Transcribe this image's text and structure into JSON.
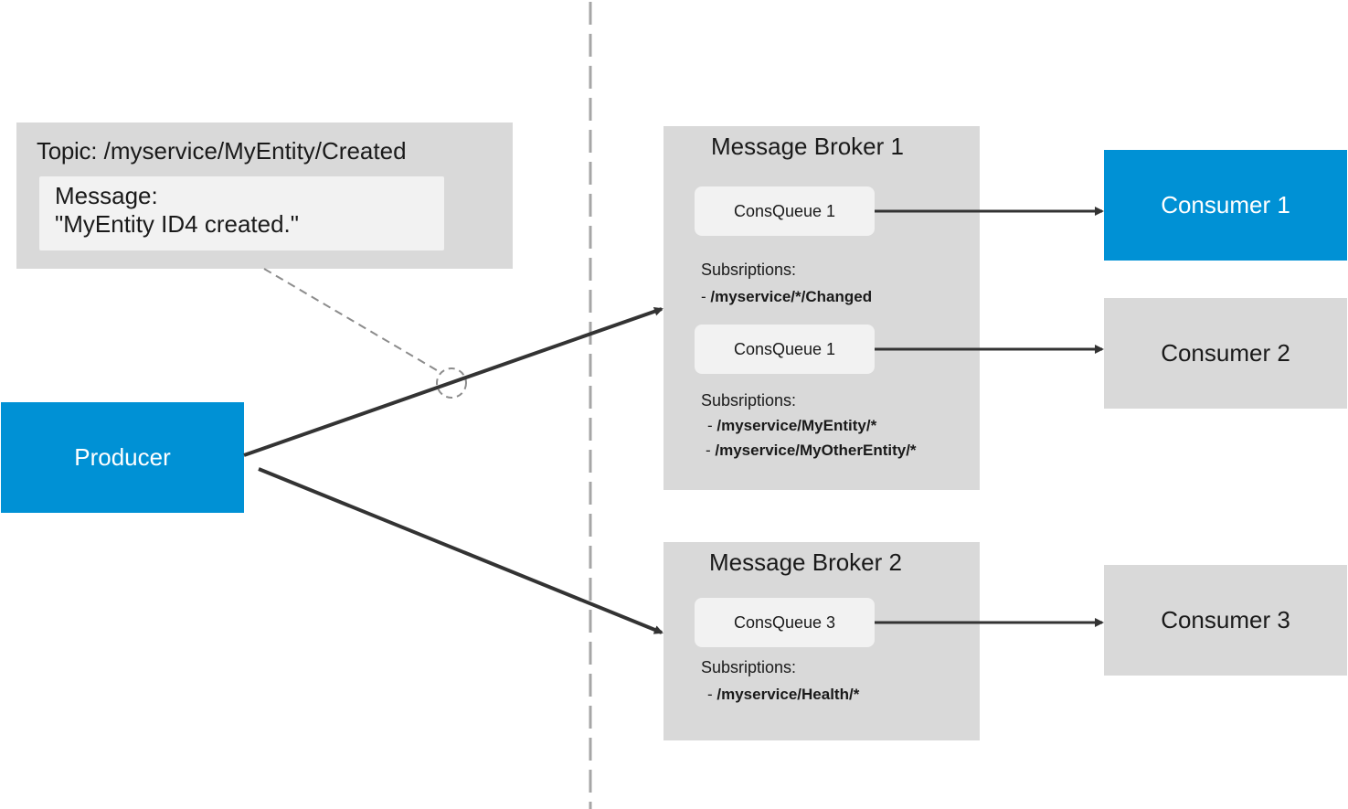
{
  "colors": {
    "accent_blue": "#0091d5",
    "box_gray": "#d9d9d9",
    "box_light": "#f2f2f2",
    "arrow": "#333333",
    "divider": "#a6a6a6"
  },
  "message_card": {
    "topic_label": "Topic",
    "topic_separator": ":",
    "topic_value": " /myservice/MyEntity/Created",
    "message_label": "Message",
    "message_separator": ":",
    "message_text": "\"MyEntity ID4 created.\""
  },
  "producer": {
    "label": "Producer"
  },
  "brokers": [
    {
      "title": "Message Broker 1",
      "queues": [
        {
          "name": "ConsQueue 1",
          "subscriptions_label": "Subsriptions:",
          "subscriptions": [
            "/myservice/*/Changed"
          ]
        },
        {
          "name": "ConsQueue 1",
          "subscriptions_label": "Subsriptions:",
          "subscriptions": [
            "/myservice/MyEntity/*",
            "/myservice/MyOtherEntity/*"
          ]
        }
      ]
    },
    {
      "title": "Message Broker 2",
      "queues": [
        {
          "name": "ConsQueue 3",
          "subscriptions_label": "Subsriptions:",
          "subscriptions": [
            "/myservice/Health/*"
          ]
        }
      ]
    }
  ],
  "consumers": [
    {
      "label": "Consumer 1",
      "highlighted": true
    },
    {
      "label": "Consumer 2",
      "highlighted": false
    },
    {
      "label": "Consumer 3",
      "highlighted": false
    }
  ],
  "edges": [
    {
      "from": "Producer",
      "to": "Message Broker 1",
      "style": "solid-arrow"
    },
    {
      "from": "Producer",
      "to": "Message Broker 2",
      "style": "solid-arrow"
    },
    {
      "from": "ConsQueue 1",
      "to": "Consumer 1",
      "style": "solid-arrow"
    },
    {
      "from": "ConsQueue 1",
      "to": "Consumer 2",
      "style": "solid-arrow"
    },
    {
      "from": "ConsQueue 3",
      "to": "Consumer 3",
      "style": "solid-arrow"
    },
    {
      "from": "Message card",
      "to": "Producer-to-Broker-1 edge",
      "style": "dashed-callout"
    }
  ],
  "sub_dash": "- "
}
